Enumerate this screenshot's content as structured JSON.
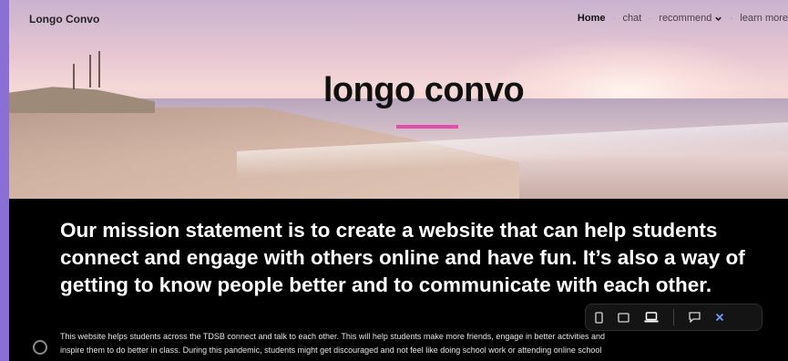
{
  "header": {
    "brand": "Longo Convo",
    "nav": {
      "home": "Home",
      "chat": "chat",
      "recommend": "recommend",
      "learn_more": "learn more",
      "separator": "·"
    }
  },
  "hero": {
    "title": "longo convo",
    "accent_color": "#e34eaa"
  },
  "mission": {
    "heading": "Our mission statement is to create a website that can help students connect and engage with others online and have fun. It’s also a way of getting to know people better and to communicate with each other.",
    "body_line1": "This website helps students across the TDSB connect and talk to each other. This will help students make more friends, engage in better activities and",
    "body_line2": "inspire them to do better in class. During this pandemic, students might get discouraged and not feel like doing school work or attending online school"
  },
  "device_toolbar": {
    "icons": [
      "phone-icon",
      "tablet-icon",
      "laptop-icon",
      "comment-icon",
      "close-icon"
    ]
  }
}
